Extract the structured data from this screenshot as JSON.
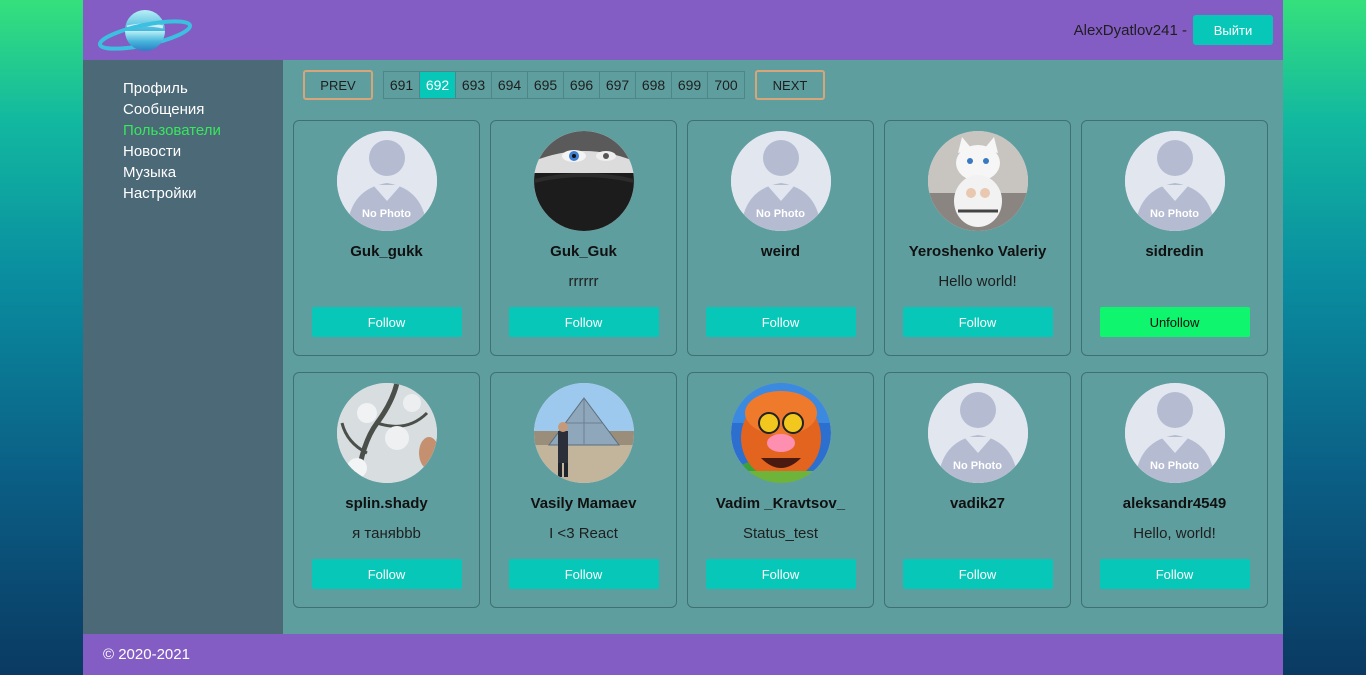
{
  "header": {
    "user": "AlexDyatlov241 -",
    "logout_label": "Выйти"
  },
  "nav": [
    {
      "label": "Профиль",
      "active": false
    },
    {
      "label": "Сообщения",
      "active": false
    },
    {
      "label": "Пользователи",
      "active": true
    },
    {
      "label": "Новости",
      "active": false
    },
    {
      "label": "Музыка",
      "active": false
    },
    {
      "label": "Настройки",
      "active": false
    }
  ],
  "pager": {
    "prev_label": "PREV",
    "next_label": "NEXT",
    "pages": [
      "691",
      "692",
      "693",
      "694",
      "695",
      "696",
      "697",
      "698",
      "699",
      "700"
    ],
    "current": "692"
  },
  "no_photo_label": "No Photo",
  "users": [
    {
      "name": "Guk_gukk",
      "status": "",
      "photo": "none",
      "button": "Follow"
    },
    {
      "name": "Guk_Guk",
      "status": "rrrrrr",
      "photo": "eye",
      "button": "Follow"
    },
    {
      "name": "weird",
      "status": "",
      "photo": "none",
      "button": "Follow"
    },
    {
      "name": "Yeroshenko Valeriy",
      "status": "Hello world!",
      "photo": "cat",
      "button": "Follow"
    },
    {
      "name": "sidredin",
      "status": "",
      "photo": "none",
      "button": "Unfollow"
    },
    {
      "name": "splin.shady",
      "status": "я таняbbb",
      "photo": "snow",
      "button": "Follow"
    },
    {
      "name": "Vasily Mamaev",
      "status": "I <3 React",
      "photo": "louvre",
      "button": "Follow"
    },
    {
      "name": "Vadim _Kravtsov_",
      "status": "Status_test",
      "photo": "muppet",
      "button": "Follow"
    },
    {
      "name": "vadik27",
      "status": "",
      "photo": "none",
      "button": "Follow"
    },
    {
      "name": "aleksandr4549",
      "status": "Hello, world!",
      "photo": "none",
      "button": "Follow"
    }
  ],
  "footer": {
    "copyright": "© 2020-2021"
  },
  "colors": {
    "header_bg": "#835dc4",
    "nav_bg": "#4c6978",
    "content_bg": "#5f9e9f",
    "accent": "#07c8b8",
    "unfollow": "#0ff56e",
    "active_nav": "#37e85c"
  }
}
